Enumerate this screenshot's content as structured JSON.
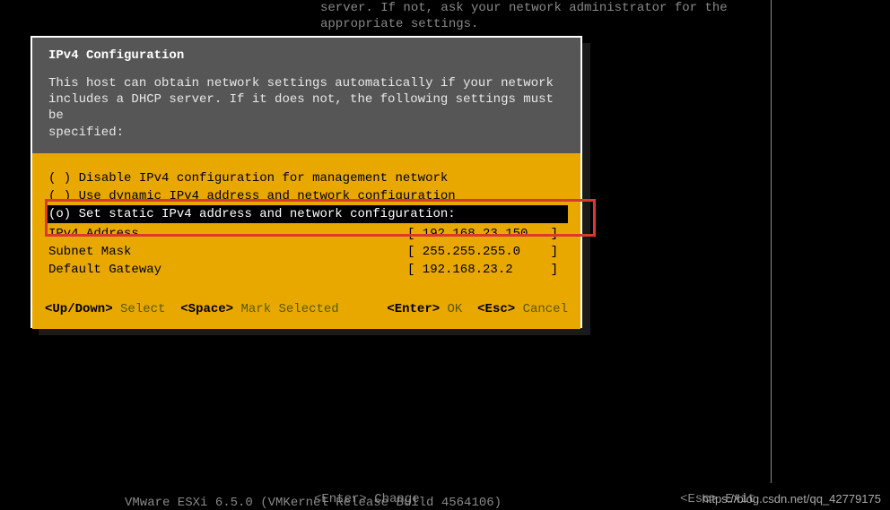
{
  "background": {
    "line1": "server. If not, ask your network administrator for the",
    "line2": "appropriate settings."
  },
  "dialog": {
    "title": "IPv4 Configuration",
    "description_line1": "This host can obtain network settings automatically if your network",
    "description_line2": "includes a DHCP server. If it does not, the following settings must be",
    "description_line3": "specified:",
    "options": [
      {
        "marker": "( )",
        "label": "Disable IPv4 configuration for management network"
      },
      {
        "marker": "( )",
        "label": "Use dynamic IPv4 address and network configuration"
      },
      {
        "marker": "(o)",
        "label": "Set static IPv4 address and network configuration:"
      }
    ],
    "fields": [
      {
        "label": "IPv4 Address",
        "value": "[ 192.168.23.150   ]"
      },
      {
        "label": "Subnet Mask",
        "value": "[ 255.255.255.0    ]"
      },
      {
        "label": "Default Gateway",
        "value": "[ 192.168.23.2     ]"
      }
    ],
    "footer": {
      "updown_key": "<Up/Down>",
      "updown_action": "Select",
      "space_key": "<Space>",
      "space_action": "Mark Selected",
      "enter_key": "<Enter>",
      "enter_action": "OK",
      "esc_key": "<Esc>",
      "esc_action": "Cancel"
    }
  },
  "bottom_bar": {
    "enter_key": "<Enter>",
    "enter_action": "Change",
    "esc_key": "<Esc>",
    "esc_action": "Exit"
  },
  "vmware_line": "VMware ESXi 6.5.0 (VMKernel Release Build 4564106)",
  "watermark": "https://blog.csdn.net/qq_42779175"
}
